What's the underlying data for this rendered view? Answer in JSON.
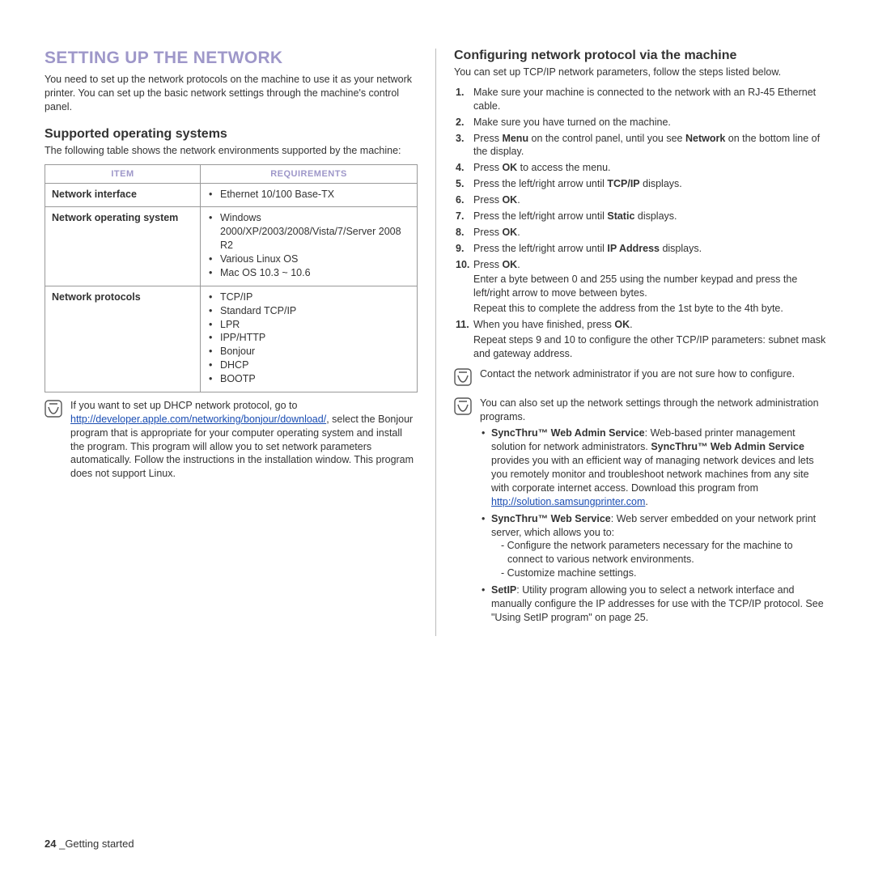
{
  "header": {
    "main_title": "SETTING UP THE NETWORK",
    "intro": "You need to set up the network protocols on the machine to use it as your network printer. You can set up the basic network settings through the machine's control panel."
  },
  "left": {
    "subhead": "Supported operating systems",
    "subintro": "The following table shows the network environments supported by the machine:",
    "table": {
      "th_item": "ITEM",
      "th_req": "REQUIREMENTS",
      "rows": [
        {
          "item": "Network interface",
          "req": [
            "Ethernet 10/100 Base-TX"
          ]
        },
        {
          "item": "Network operating system",
          "req": [
            "Windows 2000/XP/2003/2008/Vista/7/Server 2008 R2",
            "Various Linux OS",
            "Mac OS 10.3 ~ 10.6"
          ]
        },
        {
          "item": "Network protocols",
          "req": [
            "TCP/IP",
            "Standard TCP/IP",
            "LPR",
            "IPP/HTTP",
            "Bonjour",
            "DHCP",
            "BOOTP"
          ]
        }
      ]
    },
    "note": {
      "pre": "If you want to set up DHCP network protocol, go to ",
      "link_text": "http://developer.apple.com/networking/bonjour/download/",
      "post": ", select the Bonjour program that is appropriate for your computer operating system and install the program. This program will allow you to set network parameters automatically. Follow the instructions in the installation window. This program does not support Linux."
    }
  },
  "right": {
    "subhead": "Configuring network protocol via the machine",
    "subintro": "You can set up TCP/IP network parameters, follow the steps listed below.",
    "steps": {
      "s1": "Make sure your machine is connected to the network with an RJ-45 Ethernet cable.",
      "s2": "Make sure you have turned on the machine.",
      "s3_a": "Press ",
      "s3_b": "Menu",
      "s3_c": " on the control panel, until you see ",
      "s3_d": "Network",
      "s3_e": " on the bottom line of the display.",
      "s4_a": "Press ",
      "s4_b": "OK",
      "s4_c": " to access the menu.",
      "s5_a": "Press the left/right arrow until ",
      "s5_b": "TCP/IP",
      "s5_c": " displays.",
      "s6_a": "Press ",
      "s6_b": "OK",
      "s6_c": ".",
      "s7_a": "Press the left/right arrow until ",
      "s7_b": "Static",
      "s7_c": " displays.",
      "s8_a": "Press ",
      "s8_b": "OK",
      "s8_c": ".",
      "s9_a": "Press the left/right arrow until ",
      "s9_b": "IP Address",
      "s9_c": " displays.",
      "s10_a": "Press ",
      "s10_b": "OK",
      "s10_c": ".",
      "s10_extra1": "Enter a byte between 0 and 255 using the number keypad and press the left/right arrow  to move between bytes.",
      "s10_extra2": "Repeat this to complete the address from the 1st byte to the 4th byte.",
      "s11_a": "When you have finished, press ",
      "s11_b": "OK",
      "s11_c": ".",
      "s11_extra1": "Repeat steps 9 and 10 to configure the other TCP/IP parameters: subnet mask and gateway address."
    },
    "note1": "Contact the network administrator if you are not sure how to configure.",
    "note2": {
      "intro": "You can also set up the network settings through the network administration programs.",
      "i1_b1": "SyncThru™ Web Admin Service",
      "i1_t1": ": Web-based printer management solution for network administrators. ",
      "i1_b2": "SyncThru™ Web Admin Service",
      "i1_t2": " provides you with an efficient way of managing network devices and lets you remotely monitor and troubleshoot network machines from any site with corporate internet access. Download this program from ",
      "i1_link": "http://solution.samsungprinter.com",
      "i1_t3": ".",
      "i2_b1": "SyncThru™ Web Service",
      "i2_t1": ": Web server embedded on your network print server, which allows you to:",
      "i2_d1": "- Configure the network parameters necessary for the machine to connect to various network environments.",
      "i2_d2": "- Customize machine settings.",
      "i3_b1": "SetIP",
      "i3_t1": ": Utility program allowing you to select a network interface and manually configure the IP addresses for use with the TCP/IP protocol. See \"Using SetIP program\" on page 25."
    }
  },
  "footer": {
    "page": "24",
    "sep": " _",
    "label": "Getting started"
  }
}
